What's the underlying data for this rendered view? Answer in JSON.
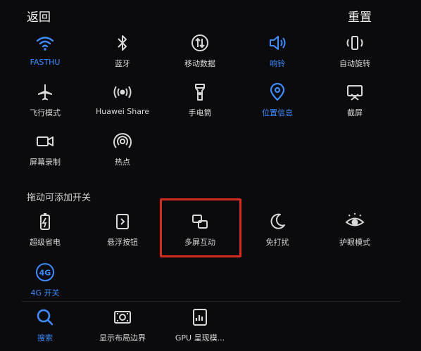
{
  "header": {
    "back_label": "返回",
    "reset_label": "重置"
  },
  "active_tiles": {
    "row1": [
      {
        "label": "FASTHU",
        "icon": "wifi-icon",
        "active": true
      },
      {
        "label": "蓝牙",
        "icon": "bluetooth-icon",
        "active": false
      },
      {
        "label": "移动数据",
        "icon": "mobile-data-icon",
        "active": false
      },
      {
        "label": "响铃",
        "icon": "speaker-icon",
        "active": true
      },
      {
        "label": "自动旋转",
        "icon": "rotate-icon",
        "active": false
      }
    ],
    "row2": [
      {
        "label": "飞行模式",
        "icon": "airplane-icon",
        "active": false
      },
      {
        "label": "Huawei Share",
        "icon": "huawei-share-icon",
        "active": false
      },
      {
        "label": "手电筒",
        "icon": "flashlight-icon",
        "active": false
      },
      {
        "label": "位置信息",
        "icon": "location-icon",
        "active": true
      },
      {
        "label": "截屏",
        "icon": "screenshot-icon",
        "active": false
      }
    ],
    "row3": [
      {
        "label": "屏幕录制",
        "icon": "screen-record-icon",
        "active": false
      },
      {
        "label": "热点",
        "icon": "hotspot-icon",
        "active": false
      }
    ]
  },
  "drag_section": {
    "label": "拖动可添加开关",
    "row1": [
      {
        "label": "超级省电",
        "icon": "power-saving-icon",
        "active": false
      },
      {
        "label": "悬浮按钮",
        "icon": "floating-button-icon",
        "active": false
      },
      {
        "label": "多屏互动",
        "icon": "multi-screen-icon",
        "active": false,
        "highlighted": true
      },
      {
        "label": "免打扰",
        "icon": "moon-icon",
        "active": false
      },
      {
        "label": "护眼模式",
        "icon": "eye-icon",
        "active": false
      }
    ],
    "row2": [
      {
        "label": "4G 开关",
        "icon": "4g-icon",
        "active": true,
        "badge": "4G"
      }
    ]
  },
  "bottom_row": [
    {
      "label": "搜索",
      "icon": "search-icon",
      "active": true
    },
    {
      "label": "显示布局边界",
      "icon": "layout-bounds-icon",
      "active": false
    },
    {
      "label": "GPU 呈现模...",
      "icon": "gpu-icon",
      "active": false
    }
  ],
  "colors": {
    "accent": "#3f8cff",
    "icon": "#d8d8d8",
    "highlight": "#d62b1f",
    "background": "#0b0b0d"
  }
}
